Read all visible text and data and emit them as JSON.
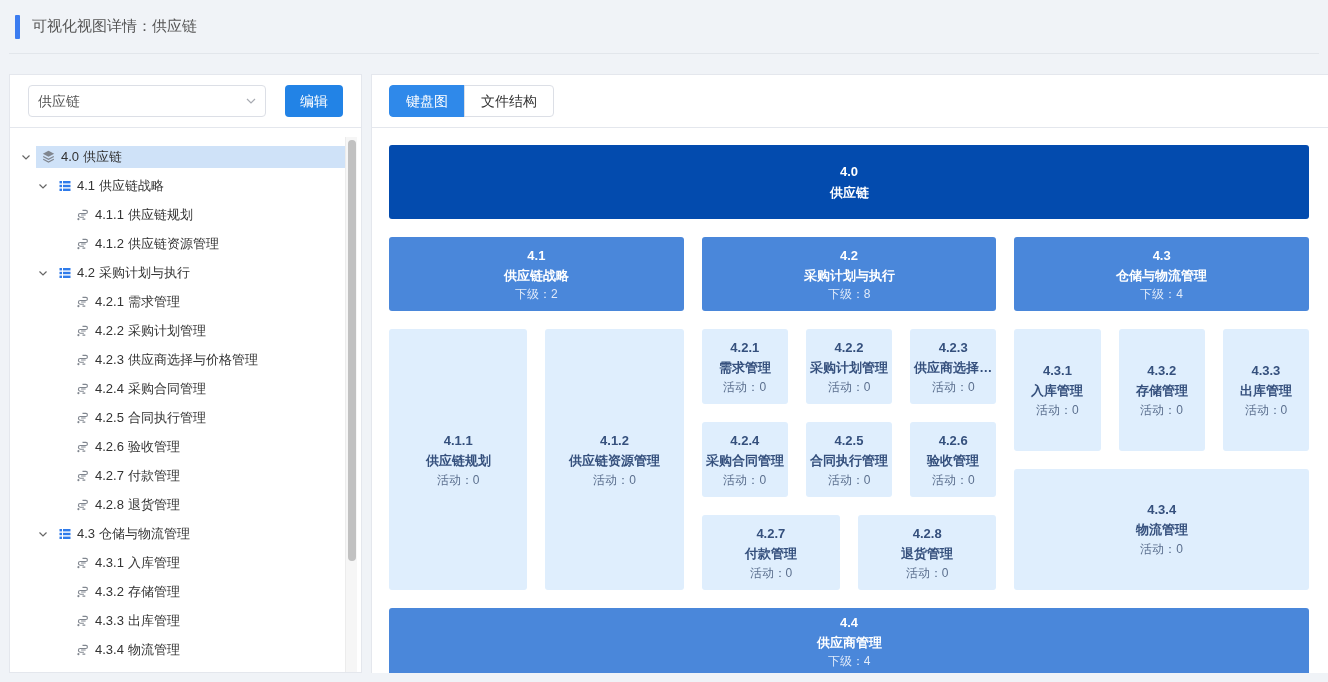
{
  "header": {
    "title": "可视化视图详情：供应链"
  },
  "sidebar": {
    "select": {
      "value": "供应链"
    },
    "edit_button": "编辑",
    "tree": [
      {
        "label": "4.0 供应链",
        "kind": "root",
        "selected": true,
        "expanded": true,
        "children": [
          {
            "label": "4.1 供应链战略",
            "kind": "group",
            "selected": false,
            "expanded": true,
            "children": [
              {
                "label": "4.1.1 供应链规划",
                "kind": "leaf",
                "selected": false
              },
              {
                "label": "4.1.2 供应链资源管理",
                "kind": "leaf",
                "selected": false
              }
            ]
          },
          {
            "label": "4.2 采购计划与执行",
            "kind": "group",
            "selected": false,
            "expanded": true,
            "children": [
              {
                "label": "4.2.1 需求管理",
                "kind": "leaf",
                "selected": false
              },
              {
                "label": "4.2.2 采购计划管理",
                "kind": "leaf",
                "selected": false
              },
              {
                "label": "4.2.3 供应商选择与价格管理",
                "kind": "leaf",
                "selected": false
              },
              {
                "label": "4.2.4 采购合同管理",
                "kind": "leaf",
                "selected": false
              },
              {
                "label": "4.2.5 合同执行管理",
                "kind": "leaf",
                "selected": false
              },
              {
                "label": "4.2.6 验收管理",
                "kind": "leaf",
                "selected": false
              },
              {
                "label": "4.2.7 付款管理",
                "kind": "leaf",
                "selected": false
              },
              {
                "label": "4.2.8 退货管理",
                "kind": "leaf",
                "selected": false
              }
            ]
          },
          {
            "label": "4.3 仓储与物流管理",
            "kind": "group",
            "selected": false,
            "expanded": true,
            "children": [
              {
                "label": "4.3.1 入库管理",
                "kind": "leaf",
                "selected": false
              },
              {
                "label": "4.3.2 存储管理",
                "kind": "leaf",
                "selected": false
              },
              {
                "label": "4.3.3 出库管理",
                "kind": "leaf",
                "selected": false
              },
              {
                "label": "4.3.4 物流管理",
                "kind": "leaf",
                "selected": false
              }
            ]
          }
        ]
      }
    ]
  },
  "view_tabs": [
    {
      "label": "键盘图",
      "selected": true
    },
    {
      "label": "文件结构",
      "selected": false
    }
  ],
  "board": {
    "root": {
      "code": "4.0",
      "name": "供应链"
    },
    "sections": [
      {
        "groups": [
          {
            "code": "4.1",
            "name": "供应链战略",
            "count": "下级：2",
            "tile_lines": [
              {
                "tiles": [
                  {
                    "code": "4.1.1",
                    "name": "供应链规划",
                    "activity": "活动：0"
                  },
                  {
                    "code": "4.1.2",
                    "name": "供应链资源管理",
                    "activity": "活动：0"
                  }
                ]
              }
            ]
          },
          {
            "code": "4.2",
            "name": "采购计划与执行",
            "count": "下级：8",
            "tile_lines": [
              {
                "tiles": [
                  {
                    "code": "4.2.1",
                    "name": "需求管理",
                    "activity": "活动：0"
                  },
                  {
                    "code": "4.2.2",
                    "name": "采购计划管理",
                    "activity": "活动：0"
                  },
                  {
                    "code": "4.2.3",
                    "name": "供应商选择…",
                    "activity": "活动：0"
                  }
                ]
              },
              {
                "tiles": [
                  {
                    "code": "4.2.4",
                    "name": "采购合同管理",
                    "activity": "活动：0"
                  },
                  {
                    "code": "4.2.5",
                    "name": "合同执行管理",
                    "activity": "活动：0"
                  },
                  {
                    "code": "4.2.6",
                    "name": "验收管理",
                    "activity": "活动：0"
                  }
                ]
              },
              {
                "tiles": [
                  {
                    "code": "4.2.7",
                    "name": "付款管理",
                    "activity": "活动：0"
                  },
                  {
                    "code": "4.2.8",
                    "name": "退货管理",
                    "activity": "活动：0"
                  }
                ]
              }
            ]
          },
          {
            "code": "4.3",
            "name": "仓储与物流管理",
            "count": "下级：4",
            "tile_lines": [
              {
                "tiles": [
                  {
                    "code": "4.3.1",
                    "name": "入库管理",
                    "activity": "活动：0"
                  },
                  {
                    "code": "4.3.2",
                    "name": "存储管理",
                    "activity": "活动：0"
                  },
                  {
                    "code": "4.3.3",
                    "name": "出库管理",
                    "activity": "活动：0"
                  }
                ]
              },
              {
                "tiles": [
                  {
                    "code": "4.3.4",
                    "name": "物流管理",
                    "activity": "活动：0"
                  }
                ]
              }
            ]
          }
        ]
      },
      {
        "groups": [
          {
            "code": "4.4",
            "name": "供应商管理",
            "count": "下级：4"
          }
        ]
      }
    ]
  }
}
